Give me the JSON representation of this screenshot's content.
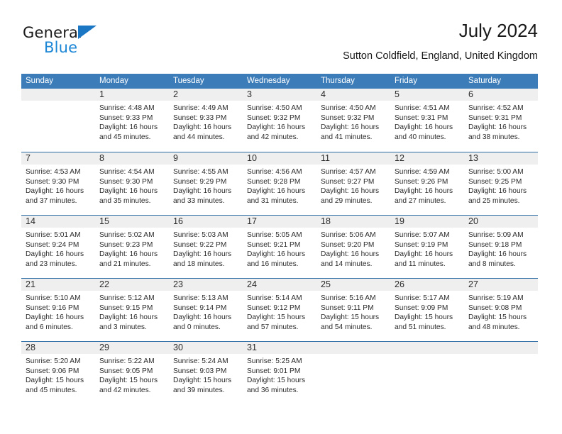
{
  "brand": {
    "name_part1": "General",
    "name_part2": "Blue",
    "accent_color": "#1b86d6",
    "triangle_color": "#1b76c4"
  },
  "header": {
    "title": "July 2024",
    "subtitle": "Sutton Coldfield, England, United Kingdom"
  },
  "theme": {
    "header_blue": "#3b7cb9",
    "row_rule_blue": "#2e6da4",
    "day_band_gray": "#efefef"
  },
  "weekdays": [
    "Sunday",
    "Monday",
    "Tuesday",
    "Wednesday",
    "Thursday",
    "Friday",
    "Saturday"
  ],
  "labels": {
    "sunrise_prefix": "Sunrise: ",
    "sunset_prefix": "Sunset: ",
    "daylight_prefix": "Daylight: "
  },
  "weeks": [
    [
      {
        "day": "",
        "empty": true
      },
      {
        "day": "1",
        "sunrise": "Sunrise: 4:48 AM",
        "sunset": "Sunset: 9:33 PM",
        "daylight": "Daylight: 16 hours and 45 minutes."
      },
      {
        "day": "2",
        "sunrise": "Sunrise: 4:49 AM",
        "sunset": "Sunset: 9:33 PM",
        "daylight": "Daylight: 16 hours and 44 minutes."
      },
      {
        "day": "3",
        "sunrise": "Sunrise: 4:50 AM",
        "sunset": "Sunset: 9:32 PM",
        "daylight": "Daylight: 16 hours and 42 minutes."
      },
      {
        "day": "4",
        "sunrise": "Sunrise: 4:50 AM",
        "sunset": "Sunset: 9:32 PM",
        "daylight": "Daylight: 16 hours and 41 minutes."
      },
      {
        "day": "5",
        "sunrise": "Sunrise: 4:51 AM",
        "sunset": "Sunset: 9:31 PM",
        "daylight": "Daylight: 16 hours and 40 minutes."
      },
      {
        "day": "6",
        "sunrise": "Sunrise: 4:52 AM",
        "sunset": "Sunset: 9:31 PM",
        "daylight": "Daylight: 16 hours and 38 minutes."
      }
    ],
    [
      {
        "day": "7",
        "sunrise": "Sunrise: 4:53 AM",
        "sunset": "Sunset: 9:30 PM",
        "daylight": "Daylight: 16 hours and 37 minutes."
      },
      {
        "day": "8",
        "sunrise": "Sunrise: 4:54 AM",
        "sunset": "Sunset: 9:30 PM",
        "daylight": "Daylight: 16 hours and 35 minutes."
      },
      {
        "day": "9",
        "sunrise": "Sunrise: 4:55 AM",
        "sunset": "Sunset: 9:29 PM",
        "daylight": "Daylight: 16 hours and 33 minutes."
      },
      {
        "day": "10",
        "sunrise": "Sunrise: 4:56 AM",
        "sunset": "Sunset: 9:28 PM",
        "daylight": "Daylight: 16 hours and 31 minutes."
      },
      {
        "day": "11",
        "sunrise": "Sunrise: 4:57 AM",
        "sunset": "Sunset: 9:27 PM",
        "daylight": "Daylight: 16 hours and 29 minutes."
      },
      {
        "day": "12",
        "sunrise": "Sunrise: 4:59 AM",
        "sunset": "Sunset: 9:26 PM",
        "daylight": "Daylight: 16 hours and 27 minutes."
      },
      {
        "day": "13",
        "sunrise": "Sunrise: 5:00 AM",
        "sunset": "Sunset: 9:25 PM",
        "daylight": "Daylight: 16 hours and 25 minutes."
      }
    ],
    [
      {
        "day": "14",
        "sunrise": "Sunrise: 5:01 AM",
        "sunset": "Sunset: 9:24 PM",
        "daylight": "Daylight: 16 hours and 23 minutes."
      },
      {
        "day": "15",
        "sunrise": "Sunrise: 5:02 AM",
        "sunset": "Sunset: 9:23 PM",
        "daylight": "Daylight: 16 hours and 21 minutes."
      },
      {
        "day": "16",
        "sunrise": "Sunrise: 5:03 AM",
        "sunset": "Sunset: 9:22 PM",
        "daylight": "Daylight: 16 hours and 18 minutes."
      },
      {
        "day": "17",
        "sunrise": "Sunrise: 5:05 AM",
        "sunset": "Sunset: 9:21 PM",
        "daylight": "Daylight: 16 hours and 16 minutes."
      },
      {
        "day": "18",
        "sunrise": "Sunrise: 5:06 AM",
        "sunset": "Sunset: 9:20 PM",
        "daylight": "Daylight: 16 hours and 14 minutes."
      },
      {
        "day": "19",
        "sunrise": "Sunrise: 5:07 AM",
        "sunset": "Sunset: 9:19 PM",
        "daylight": "Daylight: 16 hours and 11 minutes."
      },
      {
        "day": "20",
        "sunrise": "Sunrise: 5:09 AM",
        "sunset": "Sunset: 9:18 PM",
        "daylight": "Daylight: 16 hours and 8 minutes."
      }
    ],
    [
      {
        "day": "21",
        "sunrise": "Sunrise: 5:10 AM",
        "sunset": "Sunset: 9:16 PM",
        "daylight": "Daylight: 16 hours and 6 minutes."
      },
      {
        "day": "22",
        "sunrise": "Sunrise: 5:12 AM",
        "sunset": "Sunset: 9:15 PM",
        "daylight": "Daylight: 16 hours and 3 minutes."
      },
      {
        "day": "23",
        "sunrise": "Sunrise: 5:13 AM",
        "sunset": "Sunset: 9:14 PM",
        "daylight": "Daylight: 16 hours and 0 minutes."
      },
      {
        "day": "24",
        "sunrise": "Sunrise: 5:14 AM",
        "sunset": "Sunset: 9:12 PM",
        "daylight": "Daylight: 15 hours and 57 minutes."
      },
      {
        "day": "25",
        "sunrise": "Sunrise: 5:16 AM",
        "sunset": "Sunset: 9:11 PM",
        "daylight": "Daylight: 15 hours and 54 minutes."
      },
      {
        "day": "26",
        "sunrise": "Sunrise: 5:17 AM",
        "sunset": "Sunset: 9:09 PM",
        "daylight": "Daylight: 15 hours and 51 minutes."
      },
      {
        "day": "27",
        "sunrise": "Sunrise: 5:19 AM",
        "sunset": "Sunset: 9:08 PM",
        "daylight": "Daylight: 15 hours and 48 minutes."
      }
    ],
    [
      {
        "day": "28",
        "sunrise": "Sunrise: 5:20 AM",
        "sunset": "Sunset: 9:06 PM",
        "daylight": "Daylight: 15 hours and 45 minutes."
      },
      {
        "day": "29",
        "sunrise": "Sunrise: 5:22 AM",
        "sunset": "Sunset: 9:05 PM",
        "daylight": "Daylight: 15 hours and 42 minutes."
      },
      {
        "day": "30",
        "sunrise": "Sunrise: 5:24 AM",
        "sunset": "Sunset: 9:03 PM",
        "daylight": "Daylight: 15 hours and 39 minutes."
      },
      {
        "day": "31",
        "sunrise": "Sunrise: 5:25 AM",
        "sunset": "Sunset: 9:01 PM",
        "daylight": "Daylight: 15 hours and 36 minutes."
      },
      {
        "day": "",
        "empty": true
      },
      {
        "day": "",
        "empty": true
      },
      {
        "day": "",
        "empty": true
      }
    ]
  ]
}
